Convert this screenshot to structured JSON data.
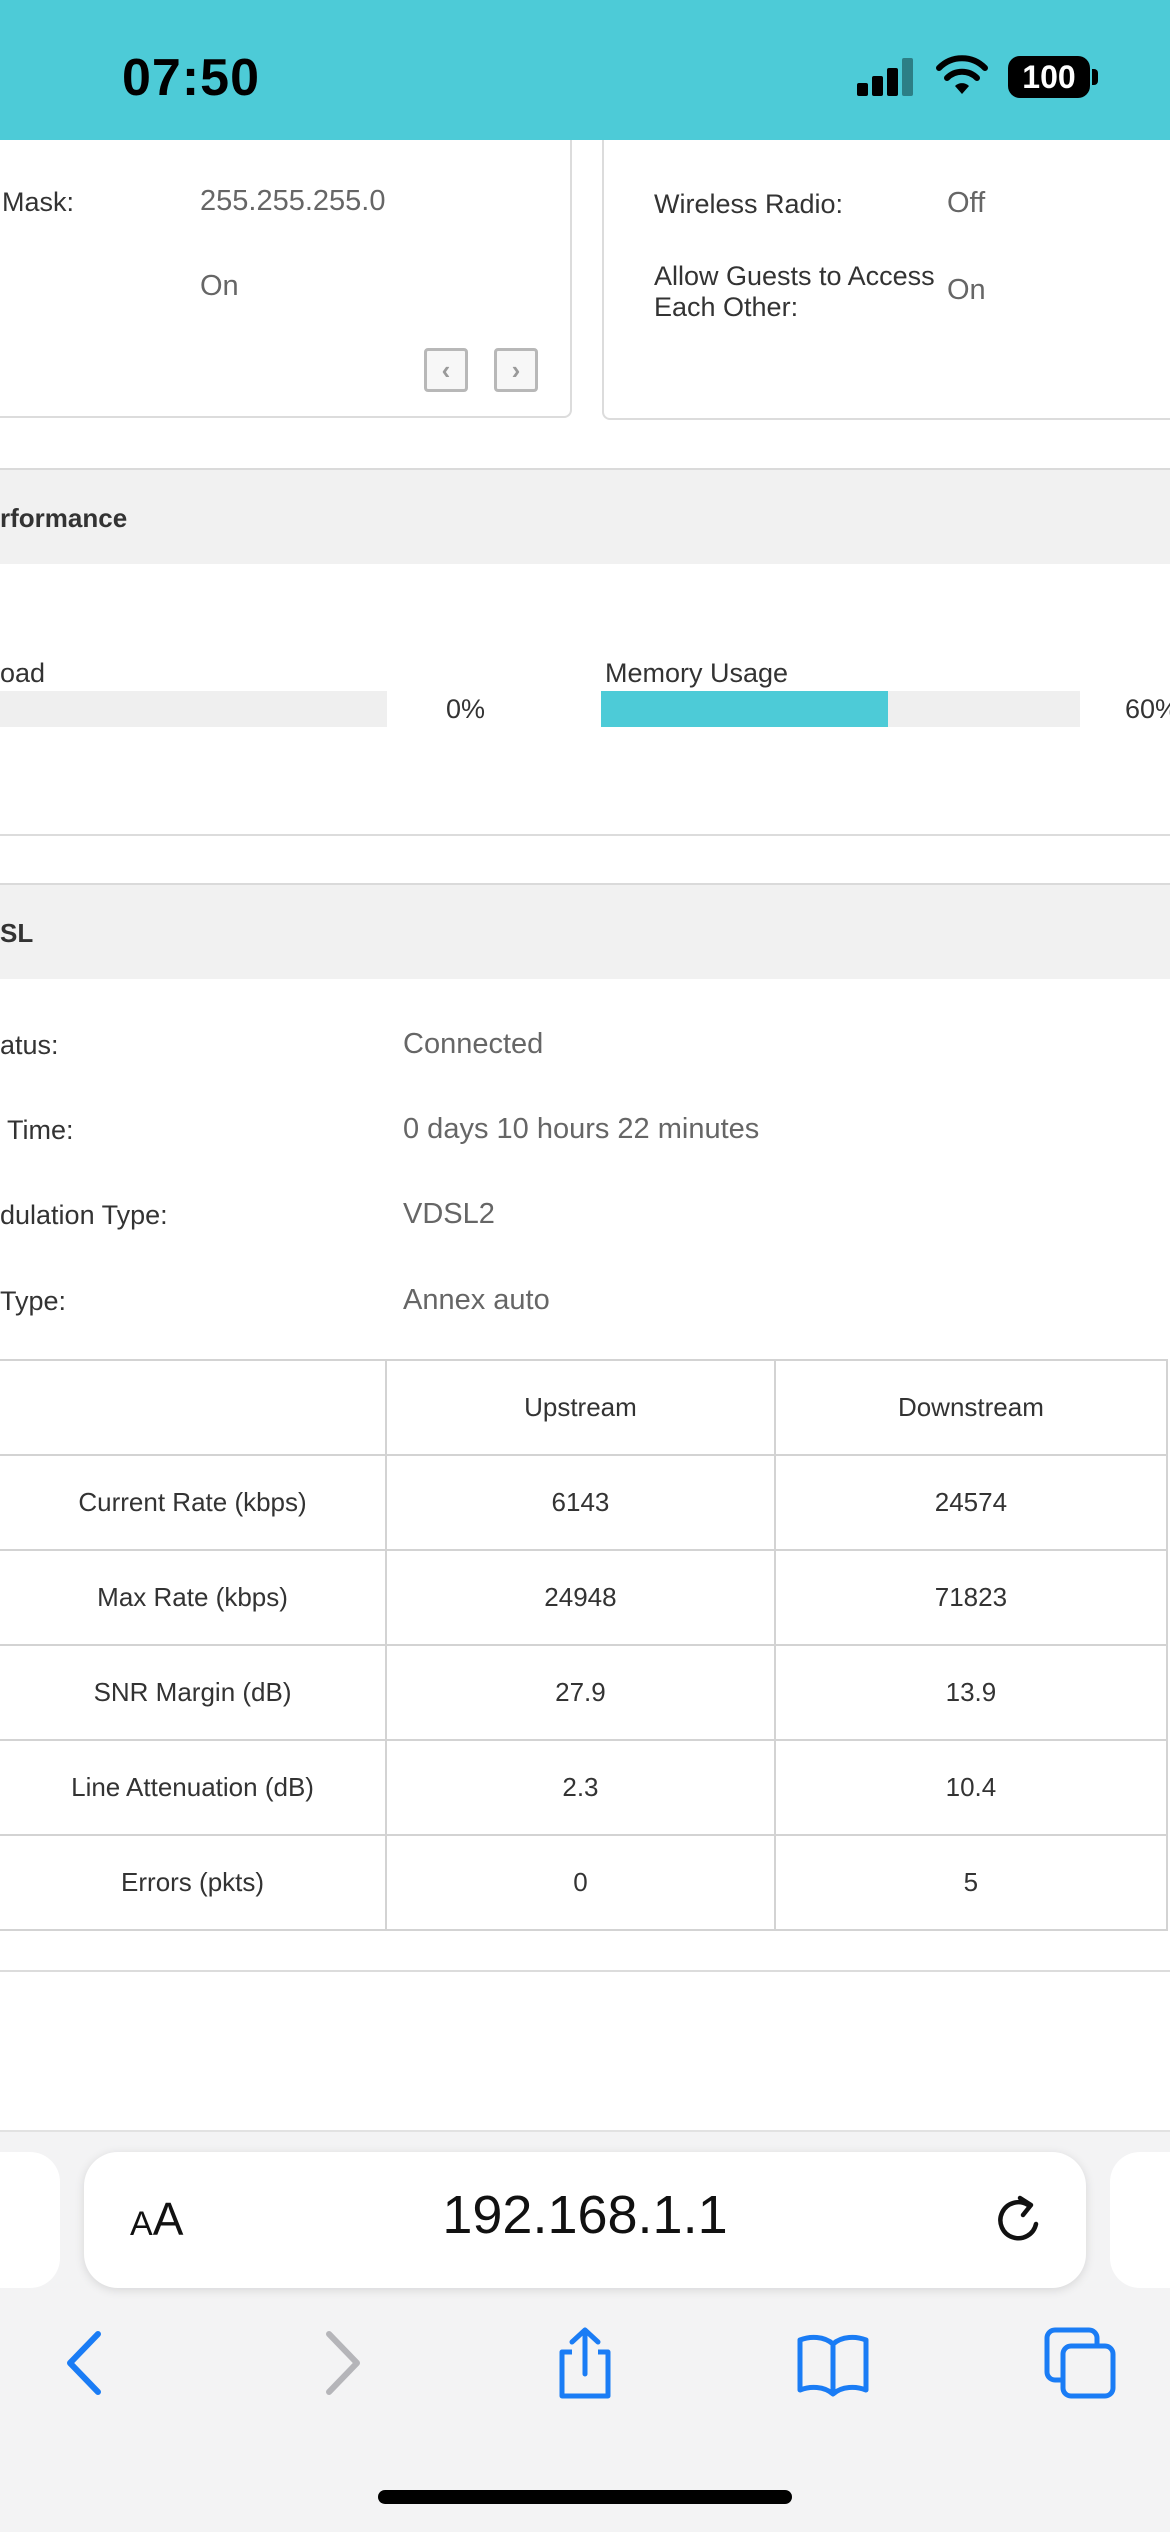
{
  "status_bar": {
    "time": "07:50",
    "battery": "100"
  },
  "lan_card": {
    "mask_label": "Mask:",
    "mask_value": "255.255.255.0",
    "dhcp_value": "On"
  },
  "wireless_card": {
    "radio_label": "Wireless Radio:",
    "radio_value": "Off",
    "guests_label_1": "Allow Guests to Access",
    "guests_label_2": "Each Other:",
    "guests_value": "On"
  },
  "performance": {
    "title": "rformance",
    "cpu_label": "oad",
    "cpu_value": "0%",
    "cpu_percent": 0,
    "memory_label": "Memory Usage",
    "memory_value": "60%",
    "memory_percent": 60
  },
  "dsl": {
    "title": "SL",
    "rows": [
      {
        "label": "atus:",
        "value": "Connected"
      },
      {
        "label": " Time:",
        "value": "0 days 10 hours 22 minutes"
      },
      {
        "label": "dulation Type:",
        "value": "VDSL2"
      },
      {
        "label": "Type:",
        "value": "Annex auto"
      }
    ],
    "table": {
      "headers": [
        "",
        "Upstream",
        "Downstream"
      ],
      "rows": [
        [
          "Current Rate (kbps)",
          "6143",
          "24574"
        ],
        [
          "Max Rate (kbps)",
          "24948",
          "71823"
        ],
        [
          "SNR Margin (dB)",
          "27.9",
          "13.9"
        ],
        [
          "Line Attenuation (dB)",
          "2.3",
          "10.4"
        ],
        [
          "Errors (pkts)",
          "0",
          "5"
        ]
      ]
    }
  },
  "browser": {
    "aa_label": "A",
    "aa_label_big": "A",
    "url": "192.168.1.1"
  },
  "colors": {
    "accent": "#4dcbd7",
    "ios_blue": "#1a7cf5"
  }
}
